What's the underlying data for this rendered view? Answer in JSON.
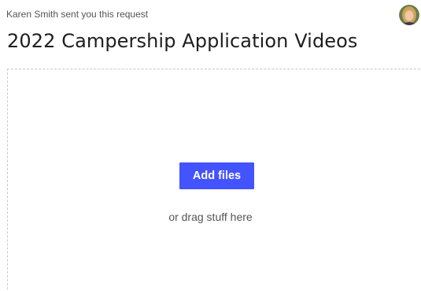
{
  "header": {
    "requester_text": "Karen Smith sent you this request",
    "title": "2022 Campership Application Videos",
    "avatar_icon": "user-avatar-icon"
  },
  "dropzone": {
    "button_label": "Add files",
    "hint": "or drag stuff here"
  },
  "colors": {
    "accent": "#4353ff",
    "title_text": "#1e1e1e",
    "muted_text": "#555555",
    "dashed_border": "#c8c8c8"
  }
}
